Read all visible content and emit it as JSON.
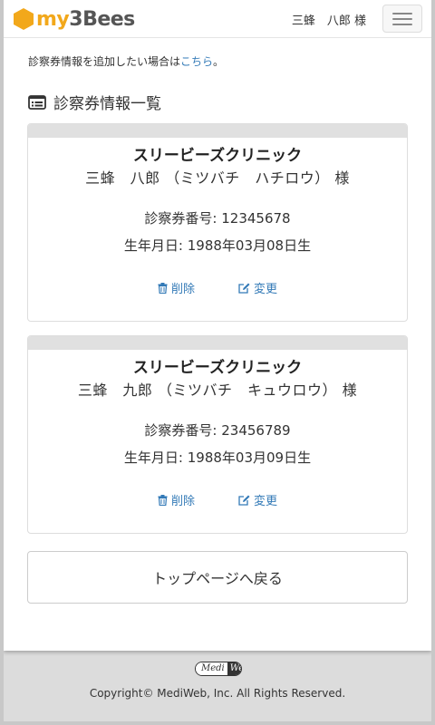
{
  "header": {
    "logo_my": "my",
    "logo_bees": "3Bees",
    "user_name": "三蜂　八郎 様"
  },
  "notice": {
    "text": "診察券情報を追加したい場合は",
    "link": "こちら",
    "suffix": "。"
  },
  "section": {
    "title": "診察券情報一覧"
  },
  "cards": [
    {
      "clinic": "スリービーズクリニック",
      "patient": "三蜂　八郎 （ミツバチ　ハチロウ） 様",
      "number": "診察券番号: 12345678",
      "birth": "生年月日: 1988年03月08日生",
      "delete_label": "削除",
      "edit_label": "変更"
    },
    {
      "clinic": "スリービーズクリニック",
      "patient": "三蜂　九郎 （ミツバチ　キュウロウ） 様",
      "number": "診察券番号: 23456789",
      "birth": "生年月日: 1988年03月09日生",
      "delete_label": "削除",
      "edit_label": "変更"
    }
  ],
  "top_button": {
    "label": "トップページへ戻る"
  },
  "footer": {
    "logo_left": "Medi",
    "logo_right": "Web",
    "copyright": "Copyright© MediWeb, Inc. All Rights Reserved."
  },
  "colors": {
    "accent": "#f2a81b",
    "link": "#337ab7",
    "card_header": "#e0e0e0",
    "footer_bg": "#dcdcdc"
  },
  "icons": {
    "logo": "hexagon-logo-icon",
    "section": "list-card-icon",
    "delete": "trash-icon",
    "edit": "edit-icon",
    "menu": "hamburger-menu-icon"
  }
}
